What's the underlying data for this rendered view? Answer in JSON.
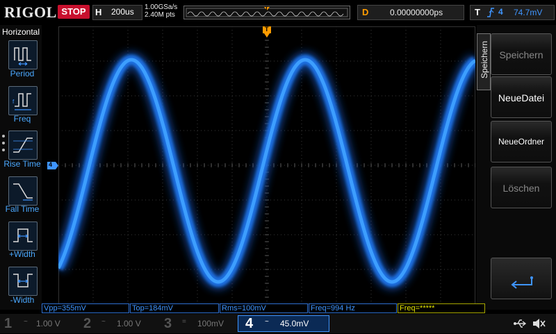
{
  "topbar": {
    "logo": "RIGOL",
    "run_state": "STOP",
    "horizontal_letter": "H",
    "timebase": "200us",
    "sample_rate": "1.00GSa/s",
    "memory_depth": "2.40M pts",
    "trigger_marker": "T",
    "delay_letter": "D",
    "delay_value": "0.00000000ps",
    "trigger_letter": "T",
    "trigger_slope_icon": "rising-edge-icon",
    "trigger_source": "4",
    "trigger_level": "74.7mV"
  },
  "left_menu": {
    "title": "Horizontal",
    "items": [
      {
        "label": "Period",
        "icon": "period-icon"
      },
      {
        "label": "Freq",
        "icon": "frequency-icon"
      },
      {
        "label": "Rise Time",
        "icon": "rise-time-icon"
      },
      {
        "label": "Fall Time",
        "icon": "fall-time-icon"
      },
      {
        "label": "+Width",
        "icon": "positive-width-icon"
      },
      {
        "label": "-Width",
        "icon": "negative-width-icon"
      }
    ]
  },
  "screen": {
    "trigger_marker": "T",
    "channel_marker": "4",
    "waveform_color": "#2e8cff"
  },
  "right_menu": {
    "tab": "Speichern",
    "keys": [
      {
        "label": "Speichern",
        "enabled": false
      },
      {
        "label": "NeueDatei",
        "enabled": true
      },
      {
        "label": "NeueOrdner",
        "enabled": true
      },
      {
        "label": "Löschen",
        "enabled": false
      }
    ],
    "enter_icon": "enter-arrow-icon"
  },
  "measurements": [
    "Vpp=355mV",
    "Top=184mV",
    "Rms=100mV",
    "Freq=994 Hz",
    "Freq=*****"
  ],
  "channels": [
    {
      "num": "1",
      "coupling": "~",
      "scale": "1.00 V"
    },
    {
      "num": "2",
      "coupling": "~",
      "scale": "1.00 V"
    },
    {
      "num": "3",
      "coupling": "=",
      "scale": "100mV"
    },
    {
      "num": "4",
      "coupling": "~",
      "scale": "45.0mV"
    }
  ],
  "status_icons": [
    "usb-icon",
    "sound-muted-icon"
  ],
  "colors": {
    "ch4": "#3f95ff",
    "stop": "#c8102e",
    "delay": "#ff9c00",
    "math": "#e6e600"
  }
}
